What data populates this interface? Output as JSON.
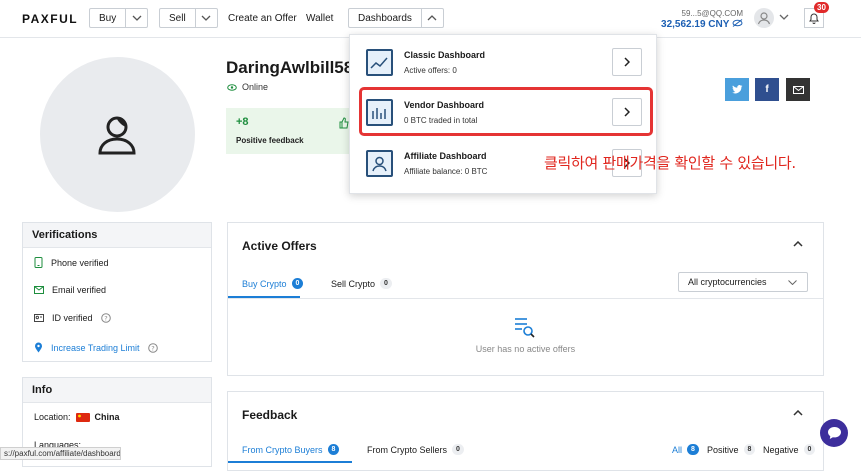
{
  "brand": {
    "logo": "PAXFUL"
  },
  "nav": {
    "buy": "Buy",
    "sell": "Sell",
    "create_offer": "Create an Offer",
    "wallet": "Wallet",
    "dashboards": "Dashboards"
  },
  "account": {
    "email": "59...5@QQ.COM",
    "balance": "32,562.19 CNY",
    "notifications": "30"
  },
  "profile": {
    "username": "DaringAwlbill58",
    "status": "Online",
    "positive_count": "+8",
    "positive_label": "Positive feedback"
  },
  "verifications": {
    "title": "Verifications",
    "items": [
      "Phone verified",
      "Email verified",
      "ID verified",
      "Increase Trading Limit"
    ]
  },
  "info": {
    "title": "Info",
    "location_label": "Location:",
    "location_value": "China",
    "languages_label": "Languages:"
  },
  "active_offers": {
    "title": "Active Offers",
    "tabs": [
      {
        "label": "Buy Crypto",
        "count": "0"
      },
      {
        "label": "Sell Crypto",
        "count": "0"
      }
    ],
    "filter": "All cryptocurrencies",
    "empty": "User has no active offers"
  },
  "feedback": {
    "title": "Feedback",
    "tabs": [
      {
        "label": "From Crypto Buyers",
        "count": "8"
      },
      {
        "label": "From Crypto Sellers",
        "count": "0"
      }
    ],
    "filters": [
      {
        "label": "All",
        "count": "8"
      },
      {
        "label": "Positive",
        "count": "8"
      },
      {
        "label": "Negative",
        "count": "0"
      }
    ]
  },
  "dashboards_menu": [
    {
      "title": "Classic Dashboard",
      "sub": "Active offers: 0"
    },
    {
      "title": "Vendor Dashboard",
      "sub": "0 BTC traded in total"
    },
    {
      "title": "Affiliate Dashboard",
      "sub": "Affiliate balance: 0 BTC"
    }
  ],
  "annotation": "클릭하여 판매가격을 확인할 수 있습니다.",
  "status_url": "s://paxful.com/affiliate/dashboard",
  "colors": {
    "accent": "#1c7ed6",
    "positive": "#1e8e3e",
    "annotation": "#e0271f",
    "twitter": "#4a9fdc",
    "facebook": "#2f4f8f",
    "email": "#333333"
  }
}
